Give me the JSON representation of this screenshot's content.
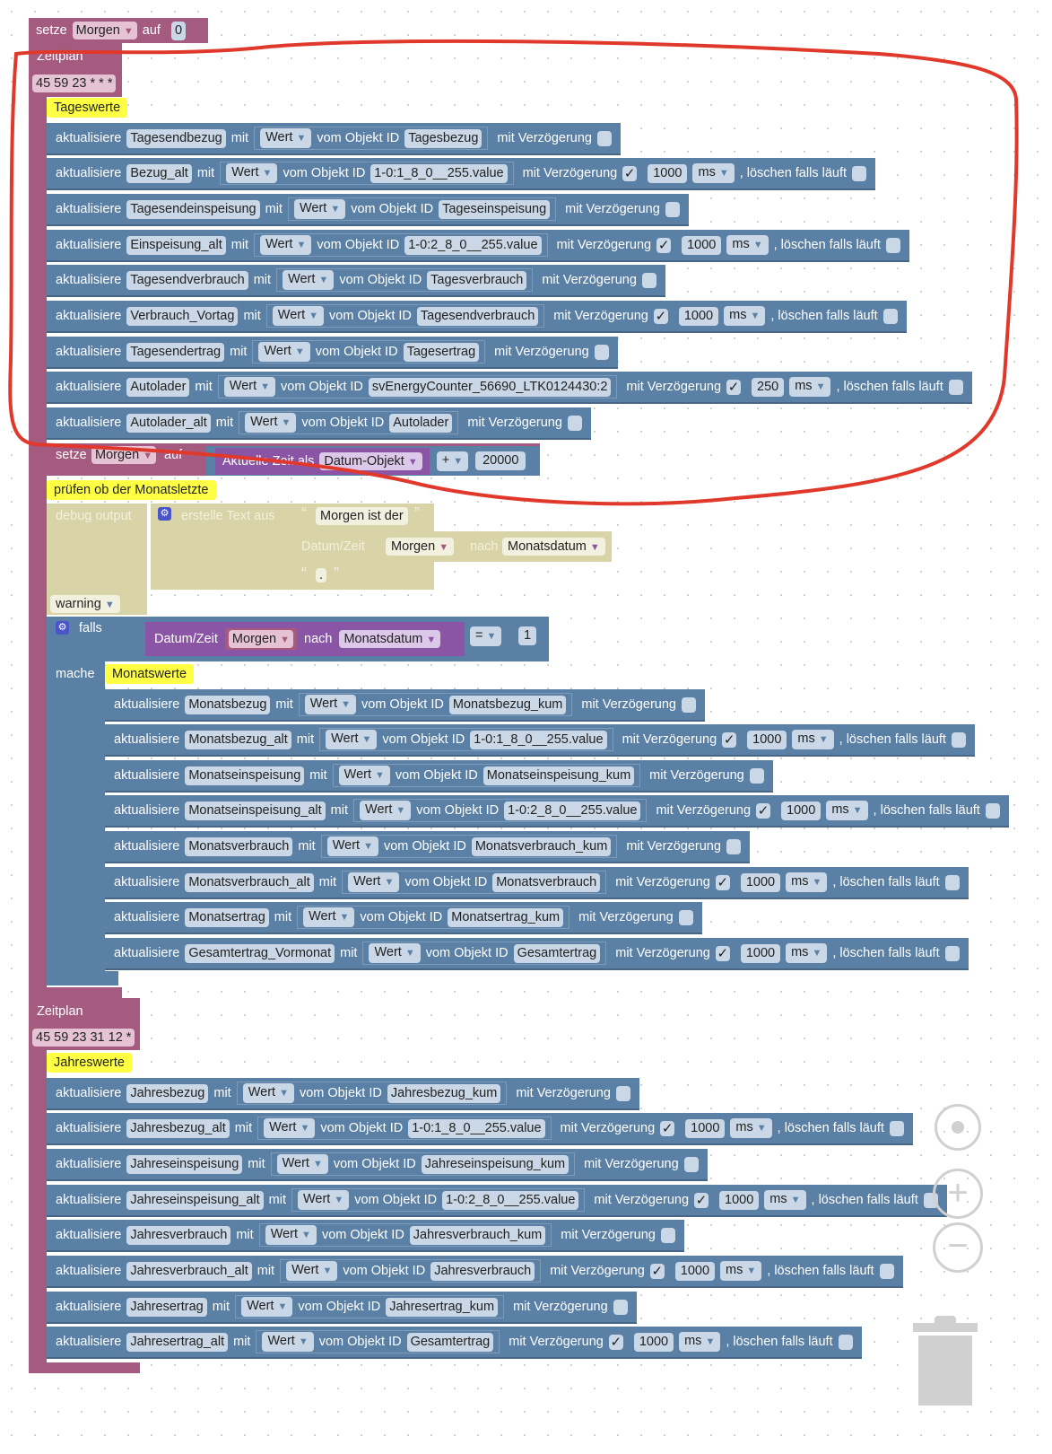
{
  "top_set": {
    "label": "setze",
    "variable": "Morgen",
    "auf": "auf",
    "value": "0"
  },
  "schedule1": {
    "label": "Zeitplan",
    "cron": "45 59 23 * * *",
    "comment": "Tageswerte"
  },
  "daily_rows": [
    {
      "var": "Tagesendbezug",
      "id": "Tagesbezug",
      "delay": false
    },
    {
      "var": "Bezug_alt",
      "id": "1-0:1_8_0__255.value",
      "delay": true,
      "ms": "1000"
    },
    {
      "var": "Tagesendeinspeisung",
      "id": "Tageseinspeisung",
      "delay": false
    },
    {
      "var": "Einspeisung_alt",
      "id": "1-0:2_8_0__255.value",
      "delay": true,
      "ms": "1000"
    },
    {
      "var": "Tagesendverbrauch",
      "id": "Tagesverbrauch",
      "delay": false
    },
    {
      "var": "Verbrauch_Vortag",
      "id": "Tagesendverbrauch",
      "delay": true,
      "ms": "1000"
    },
    {
      "var": "Tagesendertrag",
      "id": "Tagesertrag",
      "delay": false
    },
    {
      "var": "Autolader",
      "id": "svEnergyCounter_56690_LTK0124430:2",
      "delay": true,
      "ms": "250"
    },
    {
      "var": "Autolader_alt",
      "id": "Autolader",
      "delay": false
    }
  ],
  "labels": {
    "update": "aktualisiere",
    "with": "mit",
    "value": "Wert",
    "from_id": "vom Objekt ID",
    "delay": "mit Verzögerung",
    "unit": "ms",
    "clear": ", löschen falls läuft",
    "check": "✓",
    "arrow": "▼"
  },
  "set_morgen": {
    "label": "setze",
    "variable": "Morgen",
    "auf": "auf",
    "time_label": "Aktuelle Zeit als",
    "time_type": "Datum-Objekt",
    "op": "+",
    "value": "20000"
  },
  "comment_month_check": "prüfen ob der Monatsletzte",
  "debug": {
    "label": "debug output",
    "create_text": "erstelle Text aus",
    "q_open": "“",
    "q_close": "”",
    "text1": "Morgen ist der",
    "dt_label": "Datum/Zeit",
    "dt_var": "Morgen",
    "nach": "nach",
    "dt_format": "Monatsdatum",
    "text2": ".",
    "level": "warning"
  },
  "if_block": {
    "falls": "falls",
    "dt_label": "Datum/Zeit",
    "dt_var": "Morgen",
    "nach": "nach",
    "dt_format": "Monatsdatum",
    "op": "=",
    "value": "1",
    "mache": "mache",
    "comment": "Monatswerte"
  },
  "monthly_rows": [
    {
      "var": "Monatsbezug",
      "id": "Monatsbezug_kum",
      "delay": false
    },
    {
      "var": "Monatsbezug_alt",
      "id": "1-0:1_8_0__255.value",
      "delay": true,
      "ms": "1000"
    },
    {
      "var": "Monatseinspeisung",
      "id": "Monatseinspeisung_kum",
      "delay": false
    },
    {
      "var": "Monatseinspeisung_alt",
      "id": "1-0:2_8_0__255.value",
      "delay": true,
      "ms": "1000"
    },
    {
      "var": "Monatsverbrauch",
      "id": "Monatsverbrauch_kum",
      "delay": false
    },
    {
      "var": "Monatsverbrauch_alt",
      "id": "Monatsverbrauch",
      "delay": true,
      "ms": "1000"
    },
    {
      "var": "Monatsertrag",
      "id": "Monatsertrag_kum",
      "delay": false
    },
    {
      "var": "Gesamtertrag_Vormonat",
      "id": "Gesamtertrag",
      "delay": true,
      "ms": "1000"
    }
  ],
  "schedule2": {
    "label": "Zeitplan",
    "cron": "45 59 23 31 12 *",
    "comment": "Jahreswerte"
  },
  "yearly_rows": [
    {
      "var": "Jahresbezug",
      "id": "Jahresbezug_kum",
      "delay": false
    },
    {
      "var": "Jahresbezug_alt",
      "id": "1-0:1_8_0__255.value",
      "delay": true,
      "ms": "1000"
    },
    {
      "var": "Jahreseinspeisung",
      "id": "Jahreseinspeisung_kum",
      "delay": false
    },
    {
      "var": "Jahreseinspeisung_alt",
      "id": "1-0:2_8_0__255.value",
      "delay": true,
      "ms": "1000"
    },
    {
      "var": "Jahresverbrauch",
      "id": "Jahresverbrauch_kum",
      "delay": false
    },
    {
      "var": "Jahresverbrauch_alt",
      "id": "Jahresverbrauch",
      "delay": true,
      "ms": "1000"
    },
    {
      "var": "Jahresertrag",
      "id": "Jahresertrag_kum",
      "delay": false
    },
    {
      "var": "Jahresertrag_alt",
      "id": "Gesamtertrag",
      "delay": true,
      "ms": "1000"
    }
  ],
  "workspace_controls": [
    "recenter-icon",
    "zoom-in-icon",
    "zoom-out-icon",
    "trash-icon"
  ],
  "colors": {
    "variables": "#a55b80",
    "iobroker": "#5b80a5",
    "comment": "#ffff44",
    "datetime": "#8a55a5",
    "annotation": "#e0392b"
  }
}
